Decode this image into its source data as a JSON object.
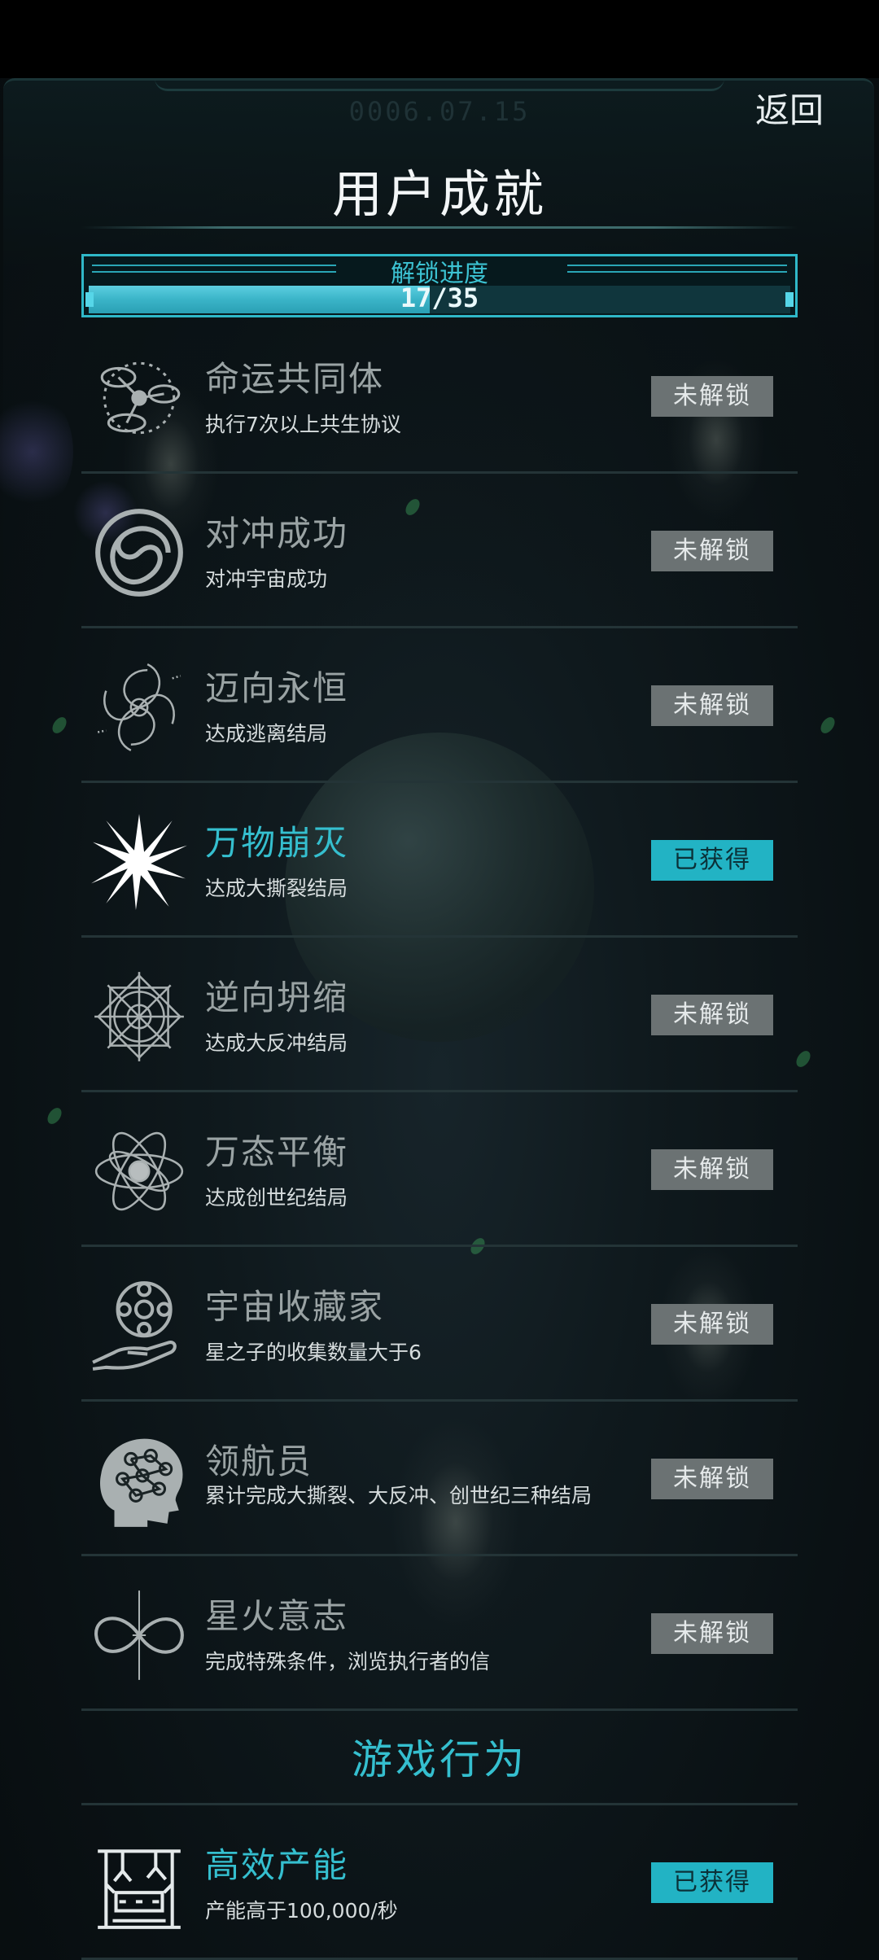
{
  "header": {
    "date": "0006.07.15",
    "back_label": "返回",
    "title": "用户成就"
  },
  "progress": {
    "label": "解锁进度",
    "unlocked": 17,
    "total": 35,
    "text": "17/35",
    "fraction": 0.4857
  },
  "achievements": [
    {
      "title": "命运共同体",
      "description": "执行7次以上共生协议",
      "status": "未解锁",
      "earned": false,
      "icon": "orbit-system-icon"
    },
    {
      "title": "对冲成功",
      "description": "对冲宇宙成功",
      "status": "未解锁",
      "earned": false,
      "icon": "spiral-vortex-icon"
    },
    {
      "title": "迈向永恒",
      "description": "达成逃离结局",
      "status": "未解锁",
      "earned": false,
      "icon": "galaxy-swirl-icon"
    },
    {
      "title": "万物崩灭",
      "description": "达成大撕裂结局",
      "status": "已获得",
      "earned": true,
      "icon": "starburst-icon"
    },
    {
      "title": "逆向坍缩",
      "description": "达成大反冲结局",
      "status": "未解锁",
      "earned": false,
      "icon": "mandala-icon"
    },
    {
      "title": "万态平衡",
      "description": "达成创世纪结局",
      "status": "未解锁",
      "earned": false,
      "icon": "atom-orbit-icon"
    },
    {
      "title": "宇宙收藏家",
      "description": "星之子的收集数量大于6",
      "status": "未解锁",
      "earned": false,
      "icon": "hand-globe-icon"
    },
    {
      "title": "领航员",
      "description": "累计完成大撕裂、大反冲、创世纪三种结局",
      "status": "未解锁",
      "earned": false,
      "icon": "brain-head-icon"
    },
    {
      "title": "星火意志",
      "description": "完成特殊条件，浏览执行者的信",
      "status": "未解锁",
      "earned": false,
      "icon": "infinity-star-icon"
    }
  ],
  "section": {
    "title": "游戏行为"
  },
  "gameplay_achievements": [
    {
      "title": "高效产能",
      "description": "产能高于100,000/秒",
      "status": "已获得",
      "earned": true,
      "icon": "factory-robot-icon"
    }
  ],
  "colors": {
    "accent": "#35bfcf",
    "locked_badge": "#6b7273",
    "earned_badge": "#22b3c4",
    "background": "#0c1518"
  }
}
